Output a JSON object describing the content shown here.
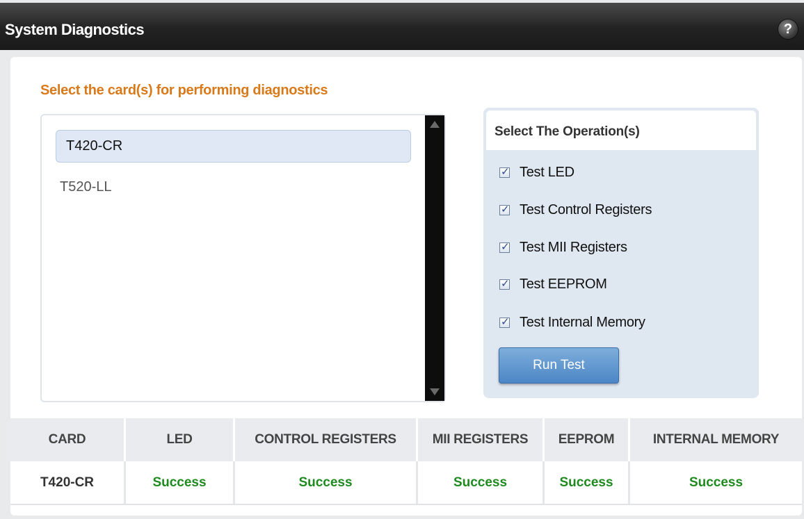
{
  "window": {
    "title": "System Diagnostics",
    "help_label": "?"
  },
  "cards_section": {
    "heading": "Select the card(s) for performing diagnostics",
    "cards": [
      "T420-CR",
      "T520-LL"
    ],
    "selected_card": "T420-CR"
  },
  "operations": {
    "heading": "Select The Operation(s)",
    "items": [
      {
        "label": "Test LED",
        "checked": true
      },
      {
        "label": "Test Control Registers",
        "checked": true
      },
      {
        "label": "Test MII Registers",
        "checked": true
      },
      {
        "label": "Test EEPROM",
        "checked": true
      },
      {
        "label": "Test Internal Memory",
        "checked": true
      }
    ],
    "run_button": "Run Test"
  },
  "results": {
    "columns": [
      "CARD",
      "LED",
      "CONTROL REGISTERS",
      "MII REGISTERS",
      "EEPROM",
      "INTERNAL MEMORY"
    ],
    "rows": [
      [
        "T420-CR",
        "Success",
        "Success",
        "Success",
        "Success",
        "Success"
      ]
    ],
    "success_color": "#1f8a1f"
  },
  "colors": {
    "accent_orange": "#d97a1a",
    "button_blue": "#4b86c6"
  }
}
